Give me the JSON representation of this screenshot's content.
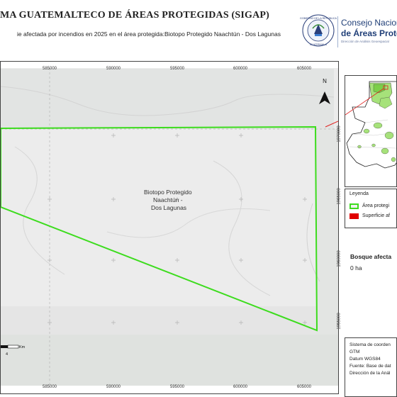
{
  "header": {
    "title": "MA GUATEMALTECO DE ÁREAS PROTEGIDAS  (SIGAP)",
    "subtitle": "ie afectada por incendios en 2025 en el área protegida:Biotopo Protegido Naachtún - Dos Lagunas",
    "logo_line1": "Consejo Nacional",
    "logo_line2": "de Áreas Protegid",
    "logo_line3": "Dirección de Análisis Geoespacial",
    "seal_text": "GOBIERNO DE LA REPÚBLICA  GUATEMALA"
  },
  "map": {
    "area_label": "Biotopo Protegido\nNaachtún -\nDos Lagunas",
    "x_ticks": [
      "585000",
      "590000",
      "595000",
      "600000",
      "605000"
    ],
    "y_ticks": [
      "1970000",
      "1965000",
      "1960000",
      "1955000"
    ],
    "north_symbol": "N",
    "scale_unit": "Km",
    "scale_value": "4",
    "colors": {
      "boundary": "#3ddc1e",
      "base": "#ececec",
      "extent_line": "#e0201e"
    }
  },
  "legend": {
    "title": "Leyenda",
    "items": [
      {
        "label": "Área protegi",
        "swatch": "outline",
        "color": "#3ddc1e"
      },
      {
        "label": "Superficie af",
        "swatch": "fill",
        "color": "#e00000"
      }
    ]
  },
  "stats": {
    "title": "Bosque afecta",
    "value": "0 ha"
  },
  "info": {
    "lines": [
      "Sistema de coorden",
      "GTM",
      "Datum WGS84",
      "Fuente: Base de dat",
      "Dirección de la Anál"
    ]
  }
}
